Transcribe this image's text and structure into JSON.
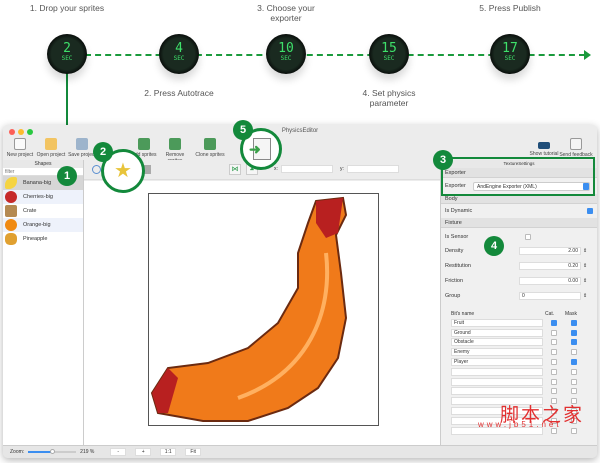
{
  "steps": [
    {
      "label": "1. Drop your sprites",
      "timer": "2",
      "unit": "SEC"
    },
    {
      "label": "2. Press Autotrace",
      "timer": "4",
      "unit": "SEC"
    },
    {
      "label": "3. Choose your exporter",
      "timer": "10",
      "unit": "SEC"
    },
    {
      "label": "4. Set physics parameter",
      "timer": "15",
      "unit": "SEC"
    },
    {
      "label": "5. Press Publish",
      "timer": "17",
      "unit": "SEC"
    }
  ],
  "badges": [
    "1",
    "2",
    "3",
    "4",
    "5"
  ],
  "window": {
    "title": "PhysicsEditor"
  },
  "toolbar": {
    "new": "New project",
    "open": "Open project",
    "save": "Save project",
    "add": "Add sprites",
    "remove": "Remove sprites",
    "clone": "Clone sprites",
    "tutorial": "Show tutorial",
    "feedback": "Send feedback"
  },
  "shapes": {
    "header": "Shapes",
    "filter_placeholder": "filter",
    "items": [
      "Banana-big",
      "Cherries-big",
      "Crate",
      "Orange-big",
      "Pineapple"
    ]
  },
  "editor": {
    "x_label": "x:",
    "y_label": "y:"
  },
  "settings": {
    "header": "TextureSettings",
    "exporter_section": "Exporter",
    "exporter_label": "Exporter",
    "exporter_value": "AndEngine Exporter (XML)",
    "body_section": "Body",
    "is_dynamic": "Is Dynamic",
    "fixture_section": "Fixture",
    "is_sensor": "Is Sensor",
    "density_label": "Density",
    "density": "2.00",
    "restitution_label": "Restitution",
    "restitution": "0.20",
    "friction_label": "Friction",
    "friction": "0.00",
    "group_label": "Group",
    "group": "0",
    "bits_header": "Bit's name",
    "cat_header": "Cat.",
    "mask_header": "Mask",
    "bits": [
      {
        "name": "Fruit",
        "cat": true,
        "mask": true
      },
      {
        "name": "Ground",
        "cat": false,
        "mask": true
      },
      {
        "name": "Obstacle",
        "cat": false,
        "mask": true
      },
      {
        "name": "Enemy",
        "cat": false,
        "mask": false
      },
      {
        "name": "Player",
        "cat": false,
        "mask": true
      },
      {
        "name": "",
        "cat": false,
        "mask": false
      },
      {
        "name": "",
        "cat": false,
        "mask": false
      },
      {
        "name": "",
        "cat": false,
        "mask": false
      },
      {
        "name": "",
        "cat": false,
        "mask": false
      },
      {
        "name": "",
        "cat": false,
        "mask": false
      },
      {
        "name": "",
        "cat": false,
        "mask": false
      },
      {
        "name": "",
        "cat": false,
        "mask": false
      }
    ]
  },
  "zoom": {
    "label": "Zoom:",
    "value": "219 %",
    "fraction": 0.5,
    "minus": "-",
    "plus": "+",
    "one": "1:1",
    "fit": "Fit"
  },
  "watermark": {
    "title": "脚本之家",
    "url": "www.jb51.net"
  },
  "colors": {
    "accent": "#13893b",
    "timer": "#3ee06a",
    "check": "#3b8ef0"
  }
}
